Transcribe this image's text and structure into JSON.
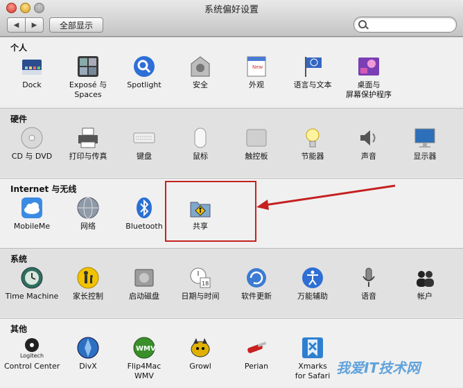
{
  "window": {
    "title": "系统偏好设置"
  },
  "toolbar": {
    "back_label": "◀",
    "forward_label": "▶",
    "show_all_label": "全部显示",
    "search_value": "",
    "search_placeholder": ""
  },
  "sections": [
    {
      "title": "个人",
      "items": [
        {
          "label": "Dock",
          "icon": "dock-icon"
        },
        {
          "label": "Exposé 与\nSpaces",
          "icon": "expose-spaces-icon"
        },
        {
          "label": "Spotlight",
          "icon": "spotlight-icon"
        },
        {
          "label": "安全",
          "icon": "security-icon"
        },
        {
          "label": "外观",
          "icon": "appearance-icon"
        },
        {
          "label": "语言与文本",
          "icon": "language-text-icon"
        },
        {
          "label": "桌面与\n屏幕保护程序",
          "icon": "desktop-screensaver-icon"
        }
      ]
    },
    {
      "title": "硬件",
      "items": [
        {
          "label": "CD 与 DVD",
          "icon": "cd-dvd-icon"
        },
        {
          "label": "打印与传真",
          "icon": "print-fax-icon"
        },
        {
          "label": "键盘",
          "icon": "keyboard-icon"
        },
        {
          "label": "鼠标",
          "icon": "mouse-icon"
        },
        {
          "label": "触控板",
          "icon": "trackpad-icon"
        },
        {
          "label": "节能器",
          "icon": "energy-saver-icon"
        },
        {
          "label": "声音",
          "icon": "sound-icon"
        },
        {
          "label": "显示器",
          "icon": "displays-icon"
        }
      ]
    },
    {
      "title": "Internet 与无线",
      "items": [
        {
          "label": "MobileMe",
          "icon": "mobileme-icon"
        },
        {
          "label": "网络",
          "icon": "network-icon"
        },
        {
          "label": "Bluetooth",
          "icon": "bluetooth-icon"
        },
        {
          "label": "共享",
          "icon": "sharing-icon"
        }
      ]
    },
    {
      "title": "系统",
      "items": [
        {
          "label": "Time Machine",
          "icon": "time-machine-icon"
        },
        {
          "label": "家长控制",
          "icon": "parental-controls-icon"
        },
        {
          "label": "启动磁盘",
          "icon": "startup-disk-icon"
        },
        {
          "label": "日期与时间",
          "icon": "date-time-icon"
        },
        {
          "label": "软件更新",
          "icon": "software-update-icon"
        },
        {
          "label": "万能辅助",
          "icon": "universal-access-icon"
        },
        {
          "label": "语音",
          "icon": "speech-icon"
        },
        {
          "label": "帐户",
          "icon": "accounts-icon"
        }
      ]
    },
    {
      "title": "其他",
      "items": [
        {
          "label": "Control Center",
          "icon": "logitech-control-center-icon",
          "brand": "Logitech"
        },
        {
          "label": "DivX",
          "icon": "divx-icon"
        },
        {
          "label": "Flip4Mac\nWMV",
          "icon": "flip4mac-icon",
          "brand": "WMV"
        },
        {
          "label": "Growl",
          "icon": "growl-icon"
        },
        {
          "label": "Perian",
          "icon": "perian-icon"
        },
        {
          "label": "Xmarks\nfor Safari",
          "icon": "xmarks-icon"
        }
      ]
    }
  ],
  "watermark": {
    "text": "我爱IT技术网"
  },
  "colors": {
    "annotation": "#c52020",
    "accent": "#3b79d8"
  }
}
